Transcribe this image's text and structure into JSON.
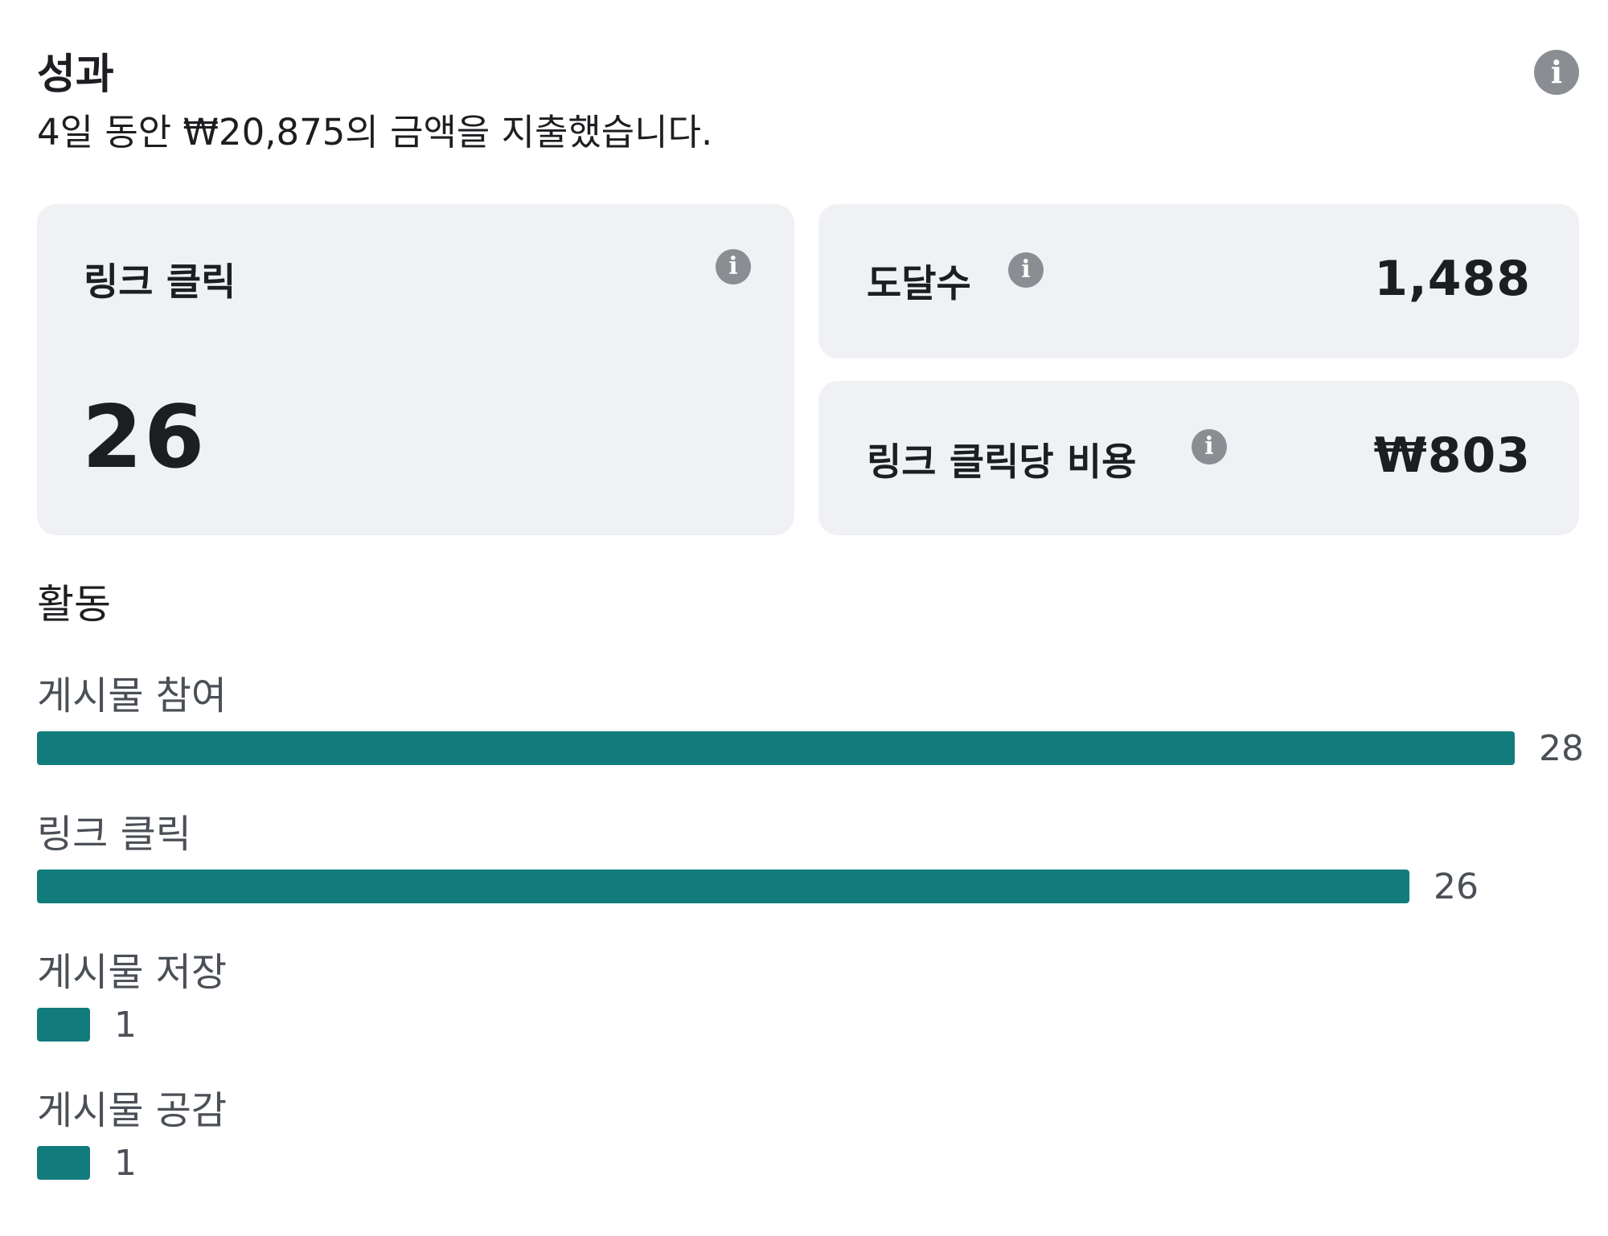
{
  "header": {
    "title": "성과",
    "subtitle": "4일 동안 ₩20,875의 금액을 지출했습니다.",
    "info_icon": "info-icon"
  },
  "metrics": {
    "link_clicks": {
      "label": "링크 클릭",
      "value": "26",
      "icon": "info-icon"
    },
    "reach": {
      "label": "도달수",
      "value": "1,488",
      "icon": "info-icon"
    },
    "cost_per_link_click": {
      "label": "링크 클릭당 비용",
      "value": "₩803",
      "icon": "info-icon"
    }
  },
  "activity": {
    "title": "활동",
    "bar_color": "#127b7c",
    "items": [
      {
        "label": "게시물 참여",
        "value": 28
      },
      {
        "label": "링크 클릭",
        "value": 26
      },
      {
        "label": "게시물 저장",
        "value": 1
      },
      {
        "label": "게시물 공감",
        "value": 1
      }
    ]
  },
  "chart_data": {
    "type": "bar",
    "categories": [
      "게시물 참여",
      "링크 클릭",
      "게시물 저장",
      "게시물 공감"
    ],
    "values": [
      28,
      26,
      1,
      1
    ],
    "title": "활동"
  }
}
